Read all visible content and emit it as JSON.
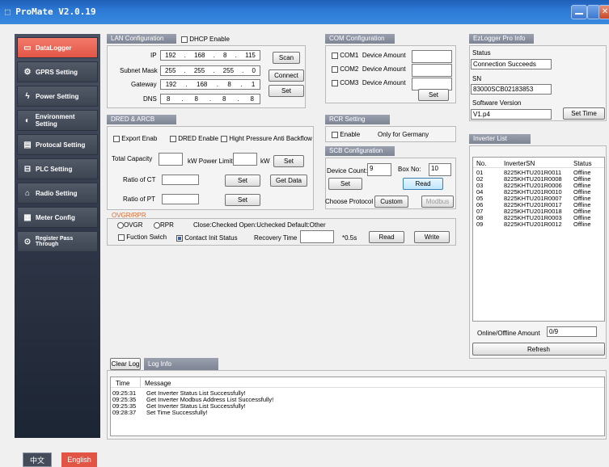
{
  "app": {
    "title": "ProMate V2.0.19"
  },
  "sidebar": {
    "items": [
      {
        "label": "DataLogger",
        "icon": "datalogger-icon"
      },
      {
        "label": "GPRS Setting",
        "icon": "gear-icon"
      },
      {
        "label": "Power Setting",
        "icon": "lightning-icon"
      },
      {
        "label": "Environment Setting",
        "icon": "environment-icon"
      },
      {
        "label": "Protocal Setting",
        "icon": "document-icon"
      },
      {
        "label": "PLC Setting",
        "icon": "plc-icon"
      },
      {
        "label": "Radio Setting",
        "icon": "radio-icon"
      },
      {
        "label": "Meter Config",
        "icon": "meter-icon"
      },
      {
        "label": "Register Pass Through",
        "icon": "register-icon"
      }
    ],
    "lang_cn": "中文",
    "lang_en": "English"
  },
  "lan": {
    "header": "LAN Configuration",
    "dhcp_label": "DHCP Enable",
    "ip_label": "IP",
    "ip": [
      "192",
      "168",
      "8",
      "115"
    ],
    "subnet_label": "Subnet Mask",
    "subnet": [
      "255",
      "255",
      "255",
      "0"
    ],
    "gateway_label": "Gateway",
    "gateway": [
      "192",
      "168",
      "8",
      "1"
    ],
    "dns_label": "DNS",
    "dns": [
      "8",
      "8",
      "8",
      "8"
    ],
    "scan": "Scan",
    "connect": "Connect",
    "set": "Set"
  },
  "com": {
    "header": "COM Configuration",
    "rows": [
      {
        "label": "COM1",
        "amount_label": "Device Amount"
      },
      {
        "label": "COM2",
        "amount_label": "Device Amount"
      },
      {
        "label": "COM3",
        "amount_label": "Device Amount"
      }
    ],
    "set": "Set"
  },
  "ezlogger": {
    "header": "EzLogger Pro Info",
    "status_label": "Status",
    "status": "Connection Succeeds",
    "sn_label": "SN",
    "sn": "83000SCB02183853",
    "version_label": "Software Version",
    "version": "V1.p4",
    "set_time": "Set Time"
  },
  "dred": {
    "header": "DRED & ARCB",
    "export_enab": "Export Enab",
    "dred_enable": "DRED Enable",
    "anti_backflow": "Hight Pressure Anti Backflow",
    "total_capacity": "Total Capacity",
    "power_limit": "kW Power Limit",
    "kw": "kW",
    "set": "Set",
    "ratio_ct": "Ratio of CT",
    "get_data": "Get Data",
    "ratio_pt": "Ratio of PT"
  },
  "rcr": {
    "header": "RCR Setting",
    "enable": "Enable",
    "note": "Only for Germany"
  },
  "scb": {
    "header": "SCB Configuration",
    "device_count_label": "Device Count:",
    "device_count": "9",
    "box_no_label": "Box No:",
    "box_no": "10",
    "set": "Set",
    "read": "Read",
    "protocol_label": "Choose Protocol",
    "custom": "Custom",
    "modbus": "Modbus"
  },
  "ovgr": {
    "header": "OVGR/RPR",
    "ovgr": "OVGR",
    "rpr": "RPR",
    "note": "Close:Checked Open:Uchecked Default:Other",
    "fuction_swich": "Fuction Swich",
    "contact_init": "Contact Init Status",
    "recovery_label": "Recovery Time",
    "unit": "*0.5s",
    "read": "Read",
    "write": "Write"
  },
  "inverter": {
    "header": "Inverter List",
    "columns": [
      "No.",
      "InverterSN",
      "Status"
    ],
    "rows": [
      [
        "01",
        "8225KHTU201R0011",
        "Offline"
      ],
      [
        "02",
        "8225KHTU201R0008",
        "Offline"
      ],
      [
        "03",
        "8225KHTU201R0006",
        "Offline"
      ],
      [
        "04",
        "8225KHTU201R0010",
        "Offline"
      ],
      [
        "05",
        "8225KHTU201R0007",
        "Offline"
      ],
      [
        "06",
        "8225KHTU201R0017",
        "Offline"
      ],
      [
        "07",
        "8225KHTU201R0018",
        "Offline"
      ],
      [
        "08",
        "8225KHTU201R0003",
        "Offline"
      ],
      [
        "09",
        "8225KHTU201R0012",
        "Offline"
      ]
    ],
    "amount_label": "Online/Offline Amount",
    "amount": "0/9",
    "refresh": "Refresh"
  },
  "log": {
    "clear": "Clear Log",
    "tab": "Log Info",
    "columns": [
      "Time",
      "Message"
    ],
    "rows": [
      [
        "09:25:31",
        "Get Inverter Status List Successfully!"
      ],
      [
        "09:25:35",
        "Get Inverter Modbus Address List Successfully!"
      ],
      [
        "09:25:35",
        "Get Inverter Status List Successfully!"
      ],
      [
        "09:28:37",
        "Set Time Successfully!"
      ]
    ]
  },
  "colors": {
    "accent": "#e25545",
    "titlebar": "#2b78d4",
    "sidebar": "#2f3647"
  }
}
